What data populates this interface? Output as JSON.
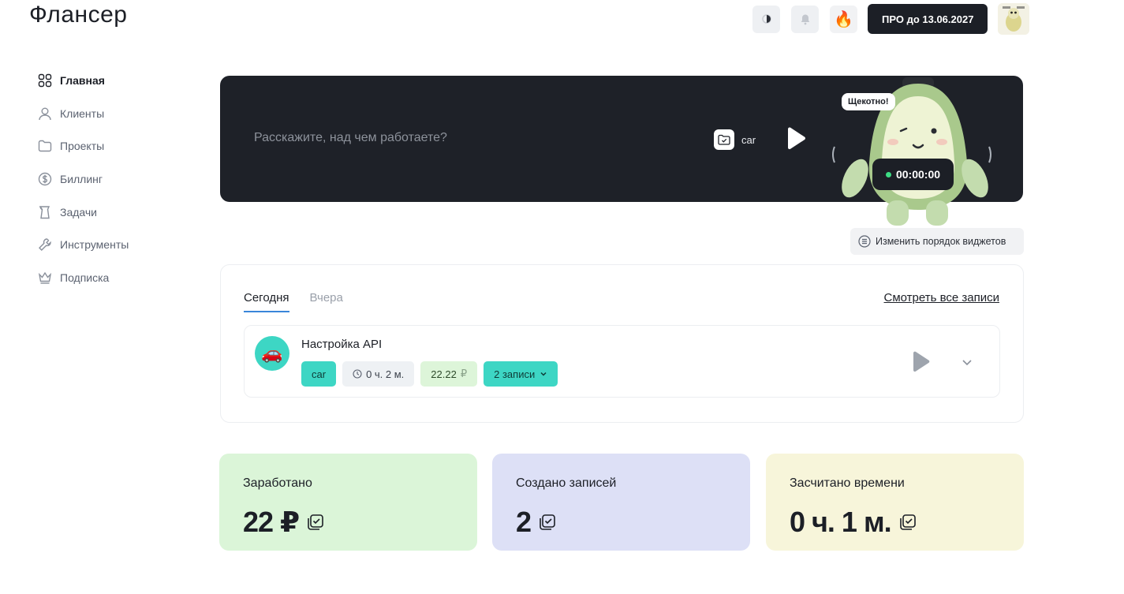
{
  "app": {
    "title": "Флансер"
  },
  "header": {
    "pro_label": "ПРО до 13.06.2027",
    "icons": [
      "theme-toggle-icon",
      "bell-icon",
      "fire-icon",
      "avatar"
    ]
  },
  "sidebar": {
    "items": [
      {
        "label": "Главная",
        "icon": "grid-icon",
        "active": true
      },
      {
        "label": "Клиенты",
        "icon": "user-icon"
      },
      {
        "label": "Проекты",
        "icon": "folder-icon"
      },
      {
        "label": "Биллинг",
        "icon": "dollar-icon"
      },
      {
        "label": "Задачи",
        "icon": "scroll-icon"
      },
      {
        "label": "Инструменты",
        "icon": "wrench-icon"
      },
      {
        "label": "Подписка",
        "icon": "crown-icon"
      }
    ]
  },
  "hero": {
    "placeholder": "Расскажите, над чем работаете?",
    "project": "car",
    "speech": "Щекотно!",
    "timer": "00:00:00"
  },
  "widget_order_label": "Изменить порядок виджетов",
  "records": {
    "tabs": [
      {
        "label": "Сегодня",
        "active": true
      },
      {
        "label": "Вчера"
      }
    ],
    "see_all": "Смотреть все записи",
    "entry": {
      "avatar_emoji": "🚗",
      "title": "Настройка API",
      "project": "car",
      "duration": "0 ч. 2 м.",
      "amount": "22.22",
      "currency": "₽",
      "count_label": "2 записи"
    }
  },
  "stats": [
    {
      "label": "Заработано",
      "value": "22 ₽",
      "color": "#dbf5d8"
    },
    {
      "label": "Создано записей",
      "value": "2",
      "color": "#dde0f6"
    },
    {
      "label": "Засчитано времени",
      "value": "0 ч. 1 м.",
      "color": "#f7f5da"
    }
  ]
}
